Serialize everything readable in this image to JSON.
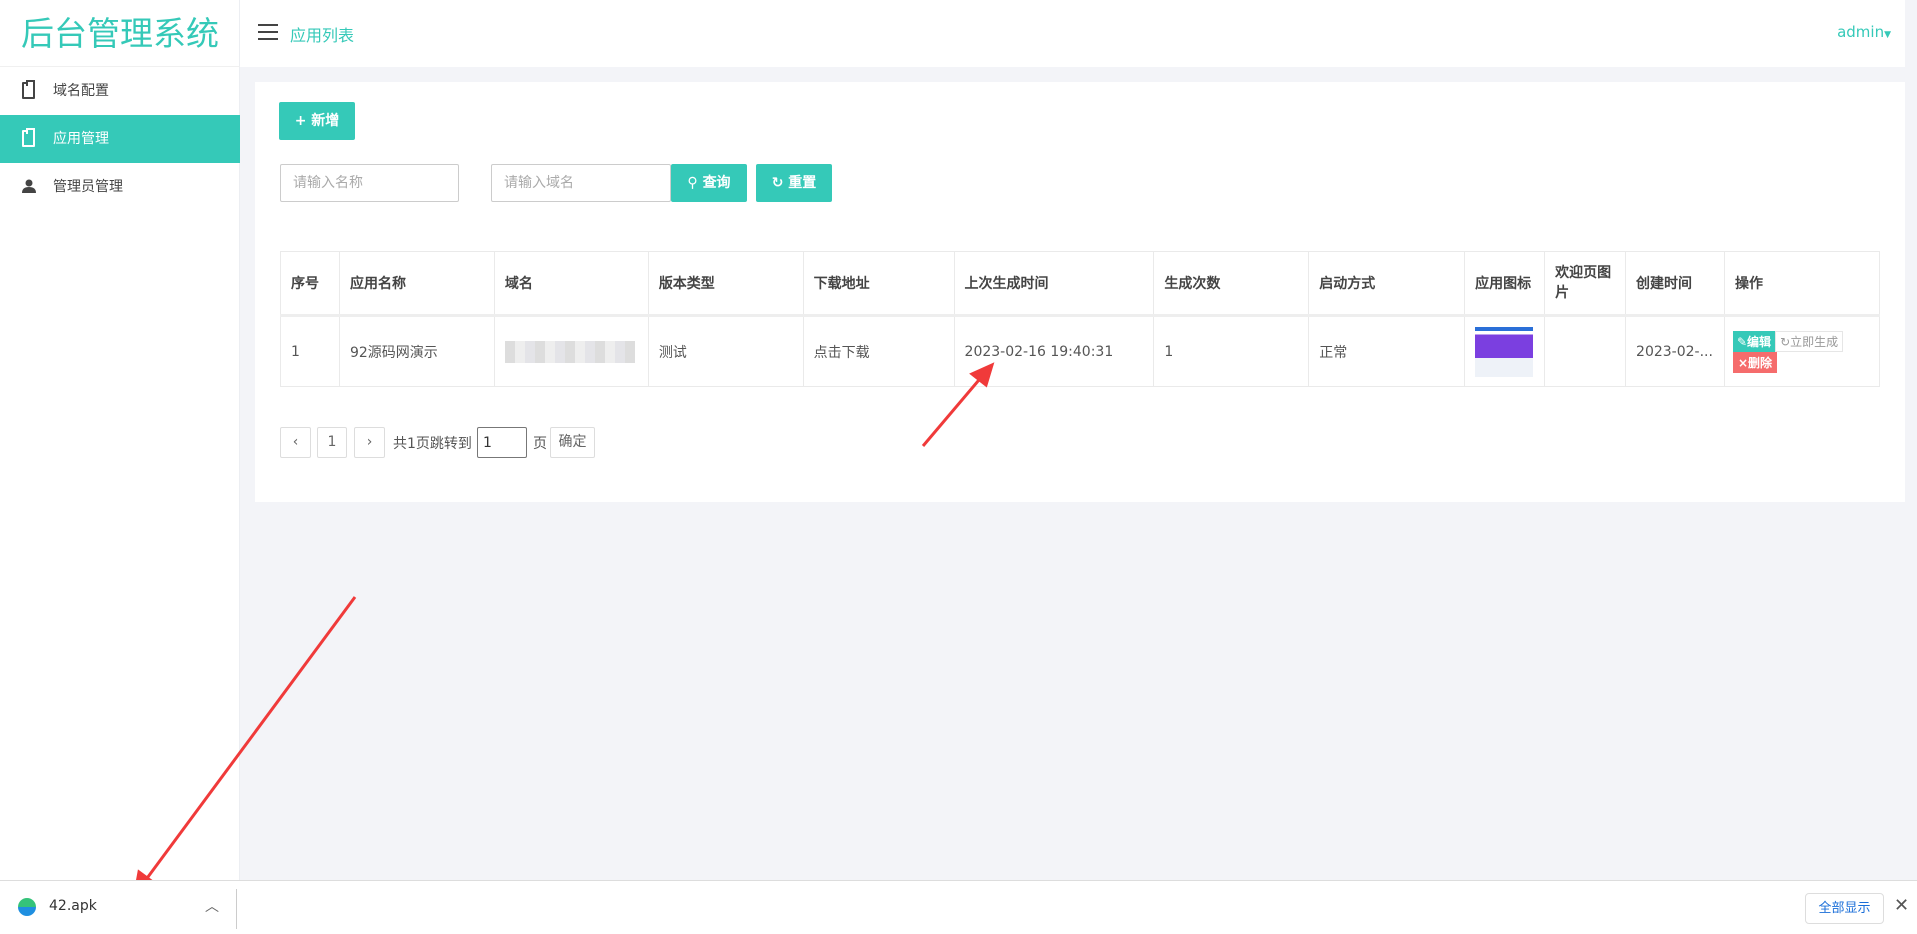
{
  "app": {
    "title": "后台管理系统",
    "page_title": "应用列表",
    "user": "admin"
  },
  "sidebar": {
    "items": [
      {
        "label": "域名配置"
      },
      {
        "label": "应用管理"
      },
      {
        "label": "管理员管理"
      }
    ]
  },
  "toolbar": {
    "add_label": "+ 新增",
    "name_placeholder": "请输入名称",
    "domain_placeholder": "请输入域名",
    "search_label": "查询",
    "reset_label": "重置"
  },
  "table": {
    "headers": [
      "序号",
      "应用名称",
      "域名",
      "版本类型",
      "下载地址",
      "上次生成时间",
      "生成次数",
      "启动方式",
      "应用图标",
      "欢迎页图片",
      "创建时间",
      "操作"
    ],
    "rows": [
      {
        "index": "1",
        "name": "92源码网演示",
        "version": "测试",
        "download": "点击下载",
        "last_generated": "2023-02-16 19:40:31",
        "count": "1",
        "launch": "正常",
        "created": "2023-02-...",
        "edit": "编辑",
        "generate": "立即生成",
        "delete": "删除"
      }
    ]
  },
  "pagination": {
    "prev": "‹",
    "page": "1",
    "next": "›",
    "total_text": "共1页跳转到",
    "jump_value": "1",
    "page_suffix": "页",
    "confirm": "确定"
  },
  "download_bar": {
    "file": "42.apk",
    "show_all": "全部显示"
  },
  "colors": {
    "accent": "#35c9b8",
    "danger": "#f56c6c",
    "arrow": "#f03a3a"
  }
}
